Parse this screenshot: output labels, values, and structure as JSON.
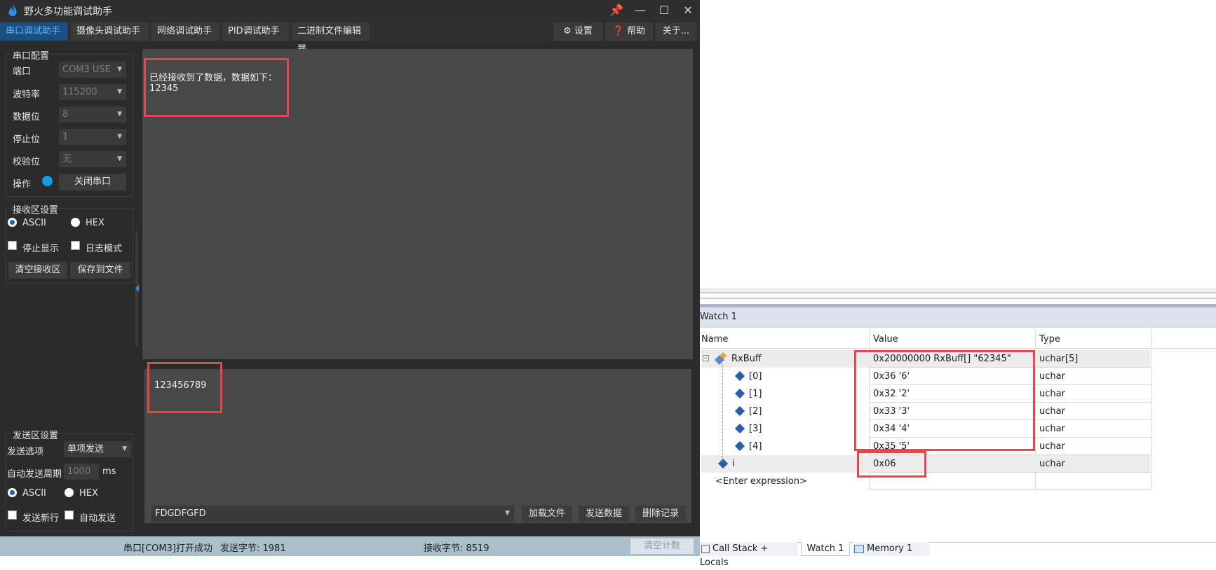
{
  "app": {
    "title": "野火多功能调试助手",
    "window_buttons": [
      "📌",
      "—",
      "☐",
      "✕"
    ],
    "menu_tabs": [
      "串口调试助手",
      "摄像头调试助手",
      "网络调试助手",
      "PID调试助手",
      "二进制文件编辑器"
    ],
    "menu_right": [
      "设置",
      "帮助",
      "关于..."
    ],
    "menu_right_icons": [
      "gear-icon",
      "help-icon"
    ],
    "serial_config": {
      "title": "串口配置",
      "port_label": "端口",
      "port_value": "COM3 USE",
      "baud_label": "波特率",
      "baud_value": "115200",
      "databits_label": "数据位",
      "databits_value": "8",
      "stopbits_label": "停止位",
      "stopbits_value": "1",
      "parity_label": "校验位",
      "parity_value": "无",
      "op_label": "操作",
      "close_button": "关闭串口",
      "status_color": "#0e9ee6"
    },
    "recv_settings": {
      "title": "接收区设置",
      "ascii": "ASCII",
      "hex": "HEX",
      "stop_display": "停止显示",
      "log_mode": "日志模式",
      "clear_button": "清空接收区",
      "save_button": "保存到文件"
    },
    "send_settings": {
      "title": "发送区设置",
      "send_option_label": "发送选项",
      "send_option_value": "单项发送",
      "period_label": "自动发送周期",
      "period_value": "1000",
      "period_unit": "ms",
      "ascii": "ASCII",
      "hex": "HEX",
      "newline": "发送新行",
      "auto_send": "自动发送"
    },
    "receive_text_line1": "已经接收到了数据，数据如下：",
    "receive_text_line2": "12345",
    "send_text": "123456789",
    "history_value": "FDGDFGFD",
    "load_file_button": "加载文件",
    "send_data_button": "发送数据",
    "delete_record_button": "删除记录",
    "status": {
      "port_status": "串口[COM3]打开成功",
      "sent_bytes": "发送字节: 1981",
      "recv_bytes": "接收字节: 8519",
      "clear_count_button": "清空计数"
    }
  },
  "debugger": {
    "watch_title": "Watch 1",
    "columns": [
      "Name",
      "Value",
      "Type"
    ],
    "rows": [
      {
        "name": "RxBuff",
        "value": "0x20000000 RxBuff[] \"62345\"",
        "type": "uchar[5]"
      },
      {
        "name": "[0]",
        "value": "0x36 '6'",
        "type": "uchar"
      },
      {
        "name": "[1]",
        "value": "0x32 '2'",
        "type": "uchar"
      },
      {
        "name": "[2]",
        "value": "0x33 '3'",
        "type": "uchar"
      },
      {
        "name": "[3]",
        "value": "0x34 '4'",
        "type": "uchar"
      },
      {
        "name": "[4]",
        "value": "0x35 '5'",
        "type": "uchar"
      },
      {
        "name": "i",
        "value": "0x06",
        "type": "uchar"
      },
      {
        "name": "<Enter expression>",
        "value": "",
        "type": ""
      }
    ],
    "tabs": [
      "Call Stack + Locals",
      "Watch 1",
      "Memory 1"
    ]
  },
  "colors": {
    "accent": "#1a4f7f",
    "highlight": "#e2484e",
    "status_bar": "#a9bfc9"
  }
}
